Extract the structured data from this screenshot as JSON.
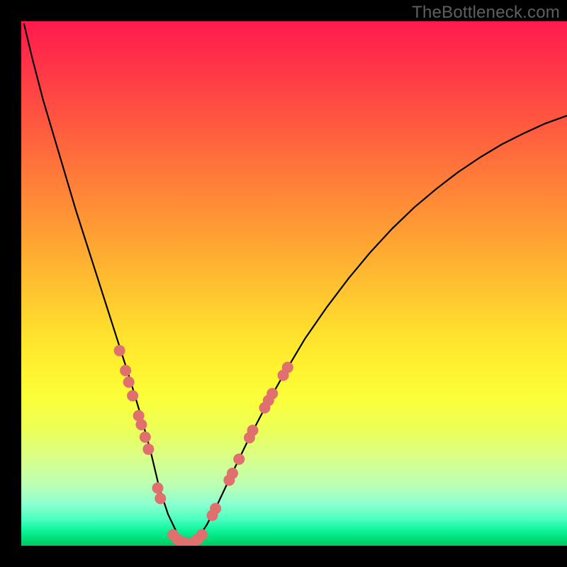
{
  "watermark": {
    "text": "TheBottleneck.com"
  },
  "chart_data": {
    "type": "line",
    "title": "",
    "xlabel": "",
    "ylabel": "",
    "xlim": [
      0,
      100
    ],
    "ylim": [
      0,
      100
    ],
    "grid": false,
    "series": [
      {
        "name": "bottleneck-curve",
        "color": "#000000",
        "x": [
          0.5,
          2,
          4,
          6,
          8,
          10,
          12,
          14,
          16,
          18,
          20,
          22,
          23.7,
          25.3,
          26.9,
          28.6,
          30,
          31.4,
          32.1,
          34,
          36,
          38.5,
          41.5,
          44.5,
          48,
          52,
          56,
          60,
          64,
          68,
          72,
          76,
          80,
          84,
          88,
          92,
          96,
          100
        ],
        "y": [
          99.5,
          93,
          85,
          78,
          71,
          64,
          57.5,
          51,
          44.5,
          38,
          31.5,
          24.5,
          18,
          11,
          6,
          2.3,
          0.5,
          0.5,
          1,
          4,
          8,
          13.5,
          20,
          26,
          32.5,
          39.5,
          45.5,
          51,
          56,
          60.5,
          64.5,
          68,
          71.2,
          74,
          76.5,
          78.6,
          80.5,
          82
        ]
      }
    ],
    "markers": {
      "name": "highlighted-points",
      "color": "#e0706e",
      "radius_px": 8,
      "points": [
        {
          "x": 18.0,
          "y": 37.2
        },
        {
          "x": 19.1,
          "y": 33.4
        },
        {
          "x": 19.7,
          "y": 31.2
        },
        {
          "x": 20.4,
          "y": 28.6
        },
        {
          "x": 21.5,
          "y": 24.8
        },
        {
          "x": 22.0,
          "y": 23.1
        },
        {
          "x": 22.7,
          "y": 20.7
        },
        {
          "x": 23.3,
          "y": 18.4
        },
        {
          "x": 25.0,
          "y": 11.0
        },
        {
          "x": 25.5,
          "y": 9.0
        },
        {
          "x": 27.8,
          "y": 2.1
        },
        {
          "x": 28.6,
          "y": 1.2
        },
        {
          "x": 29.6,
          "y": 0.7
        },
        {
          "x": 30.5,
          "y": 0.4
        },
        {
          "x": 31.3,
          "y": 0.5
        },
        {
          "x": 32.3,
          "y": 1.2
        },
        {
          "x": 33.1,
          "y": 2.1
        },
        {
          "x": 35.0,
          "y": 5.8
        },
        {
          "x": 35.6,
          "y": 7.1
        },
        {
          "x": 38.1,
          "y": 12.5
        },
        {
          "x": 38.7,
          "y": 13.8
        },
        {
          "x": 39.9,
          "y": 16.5
        },
        {
          "x": 41.8,
          "y": 20.6
        },
        {
          "x": 42.4,
          "y": 22.0
        },
        {
          "x": 44.6,
          "y": 26.3
        },
        {
          "x": 45.3,
          "y": 27.7
        },
        {
          "x": 46.0,
          "y": 29.0
        },
        {
          "x": 48.0,
          "y": 32.5
        },
        {
          "x": 48.8,
          "y": 34.0
        }
      ]
    },
    "background_gradient": {
      "direction": "vertical",
      "colors": [
        "#ff1a4d",
        "#ffe22e",
        "#00c95e"
      ]
    }
  }
}
